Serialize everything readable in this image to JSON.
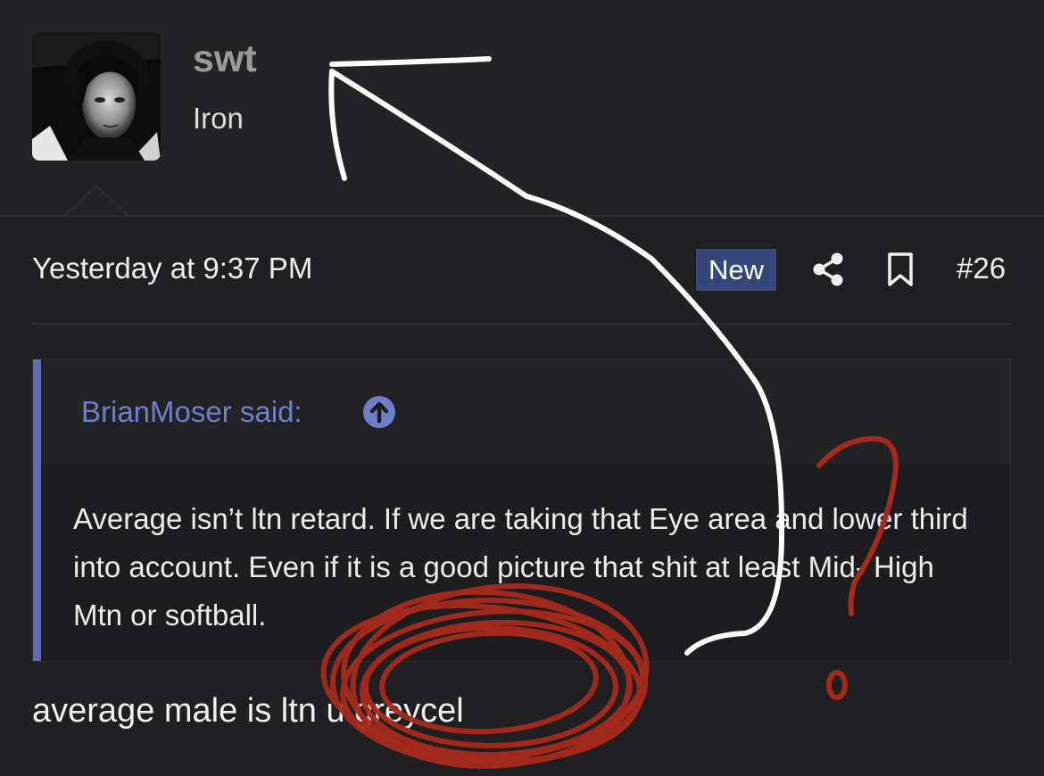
{
  "user": {
    "username": "swt",
    "title": "Iron"
  },
  "post": {
    "date": "Yesterday at 9:37 PM",
    "badge": "New",
    "number": "#26",
    "icons": [
      "share-icon",
      "bookmark-icon"
    ]
  },
  "quote": {
    "author": "BrianMoser said:",
    "body": "Average isn’t ltn retard. If we are taking that Eye area and lower third into account. Even if it is a good picture that shit at least Mid- High Mtn or softball.",
    "icon": "arrow-up-circle-icon"
  },
  "reply": {
    "text": "average male is ltn u greycel"
  },
  "colors": {
    "background": "#202022",
    "badge": "#34477a",
    "quote_accent": "#5f6bb5",
    "annotation_white": "#ffffff",
    "annotation_red": "#a82a1c"
  }
}
